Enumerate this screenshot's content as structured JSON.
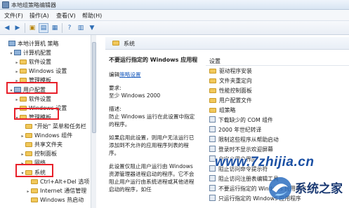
{
  "window": {
    "title": "本地组策略编辑器"
  },
  "menu": [
    "文件(F)",
    "操作(A)",
    "查看(V)",
    "帮助(H)"
  ],
  "tree": {
    "items": [
      {
        "label": "本地计算机 策略",
        "icon": "computer-policy-icon",
        "indent": 0,
        "twisty": ""
      },
      {
        "label": "计算机配置",
        "icon": "computer-icon",
        "indent": 1,
        "twisty": "▾"
      },
      {
        "label": "软件设置",
        "icon": "folder-icon",
        "indent": 2,
        "twisty": "▸"
      },
      {
        "label": "Windows 设置",
        "icon": "folder-icon",
        "indent": 2,
        "twisty": "▸"
      },
      {
        "label": "管理模板",
        "icon": "folder-icon",
        "indent": 2,
        "twisty": "▸"
      },
      {
        "label": "用户配置",
        "icon": "user-icon",
        "indent": 1,
        "twisty": "▾"
      },
      {
        "label": "软件设置",
        "icon": "folder-icon",
        "indent": 2,
        "twisty": "▸"
      },
      {
        "label": "Windows 设置",
        "icon": "folder-icon",
        "indent": 2,
        "twisty": "▸"
      },
      {
        "label": "管理模板",
        "icon": "folder-icon",
        "indent": 2,
        "twisty": "▾"
      },
      {
        "label": "\"开始\" 菜单和任务栏",
        "icon": "folder-icon",
        "indent": 3,
        "twisty": ""
      },
      {
        "label": "Windows 组件",
        "icon": "folder-icon",
        "indent": 3,
        "twisty": "▸"
      },
      {
        "label": "共享文件夹",
        "icon": "folder-icon",
        "indent": 3,
        "twisty": ""
      },
      {
        "label": "控制面板",
        "icon": "folder-icon",
        "indent": 3,
        "twisty": "▸"
      },
      {
        "label": "网络",
        "icon": "folder-icon",
        "indent": 3,
        "twisty": "▸"
      },
      {
        "label": "系统",
        "icon": "folder-icon",
        "indent": 3,
        "twisty": "▾"
      },
      {
        "label": "Ctrl+Alt+Del 选项",
        "icon": "folder-icon",
        "indent": 4,
        "twisty": ""
      },
      {
        "label": "Internet 通信管理",
        "icon": "folder-icon",
        "indent": 4,
        "twisty": "▸"
      },
      {
        "label": "Windows 热启动",
        "icon": "folder-icon",
        "indent": 4,
        "twisty": ""
      }
    ]
  },
  "content": {
    "folder_name": "系统",
    "policy_title": "不要运行指定的 Windows 应用程序",
    "edit_prefix": "编辑",
    "edit_link": "策略设置",
    "requirements_label": "要求:",
    "requirements_value": "至少 Windows 2000",
    "description_label": "描述:",
    "description_text": "防止 Windows 运行在此设置中指定的程序。",
    "para2": "如果启用此设置，则用户无法运行已添加到不允许的应用程序列表的程序。",
    "para3": "此设置仅阻止用户运行由 Windows 资源管理器进程启动的程序。它不会阻止用户运行由系统进程或其他进程启动的程序，如任"
  },
  "list": {
    "header": "设置",
    "items": [
      {
        "label": "驱动程序安装",
        "icon": "folder-icon"
      },
      {
        "label": "文件夹重定向",
        "icon": "folder-icon"
      },
      {
        "label": "性能控制面板",
        "icon": "folder-icon"
      },
      {
        "label": "用户配置文件",
        "icon": "folder-icon"
      },
      {
        "label": "组策略",
        "icon": "folder-icon"
      },
      {
        "label": "下载缺少的 COM 组件",
        "icon": "policy-setting-icon"
      },
      {
        "label": "2000 年世纪转译",
        "icon": "policy-setting-icon"
      },
      {
        "label": "限制这些程序从帮助启动",
        "icon": "policy-setting-icon"
      },
      {
        "label": "登录时不显示欢迎屏幕",
        "icon": "policy-setting-icon"
      },
      {
        "label": "自定义用户界面",
        "icon": "policy-setting-icon"
      },
      {
        "label": "阻止访问命令提示符",
        "icon": "policy-setting-icon"
      },
      {
        "label": "阻止访问注册表编辑工具",
        "icon": "policy-setting-icon"
      },
      {
        "label": "不要运行指定的 Windows 应用程序",
        "icon": "policy-setting-icon"
      },
      {
        "label": "只运行指定的 Windows 应用程序",
        "icon": "policy-setting-icon"
      }
    ]
  },
  "watermark": {
    "site": "www.7zhijia.cn",
    "brand": "系统之家"
  },
  "colors": {
    "highlight": "#e8202a",
    "link": "#1f5fbf",
    "folder": "#f1c85b"
  }
}
